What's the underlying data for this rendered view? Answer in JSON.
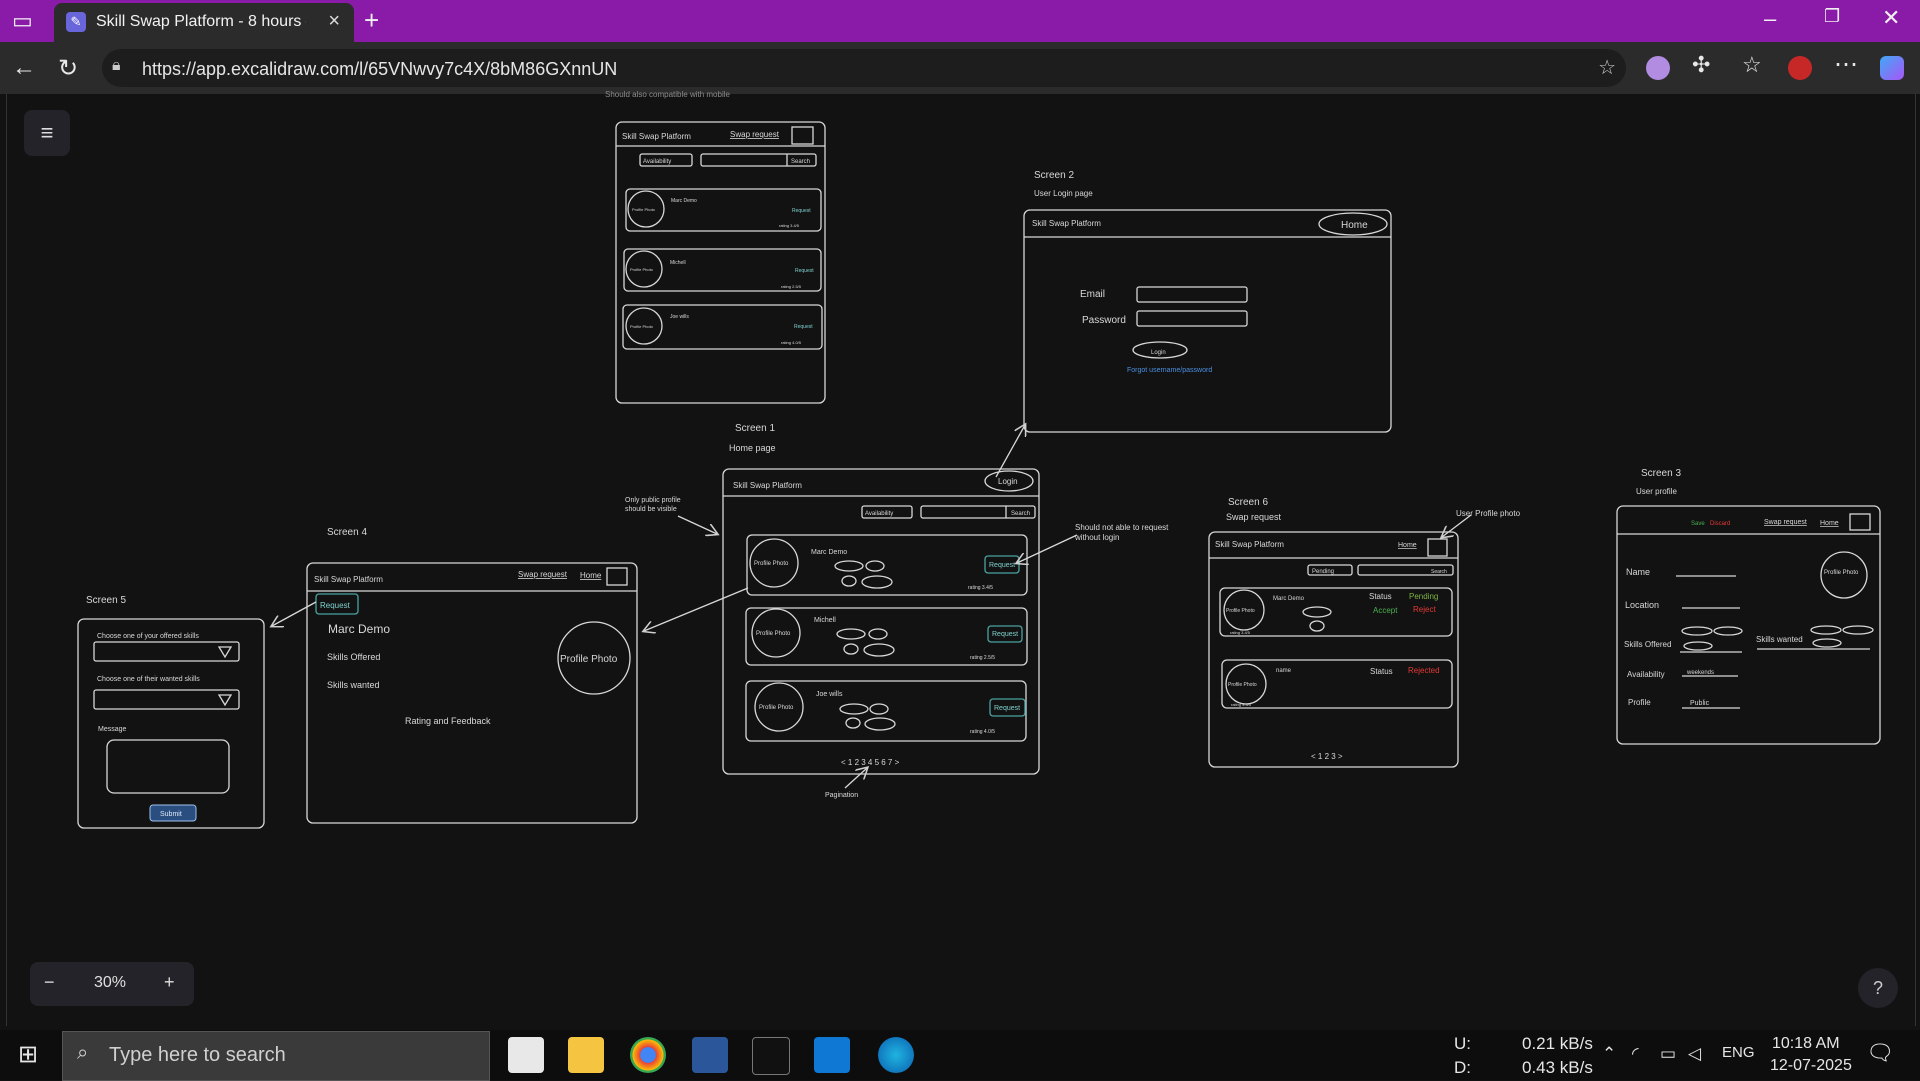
{
  "browser": {
    "tab_title": "Skill Swap Platform - 8 hours — E",
    "url": "https://app.excalidraw.com/l/65VNwvy7c4X/8bM86GXnnUN"
  },
  "canvas": {
    "top_note": "Should also compatible with mobile",
    "zoom": "30%",
    "screen0": {
      "brand": "Skill Swap Platform",
      "nav": "Swap request",
      "availability": "Availability",
      "search": "Search",
      "cards": [
        {
          "name": "Marc Demo",
          "photo": "Profile Photo",
          "btn": "Request",
          "rating": "rating 3.4/5"
        },
        {
          "name": "Michell",
          "photo": "Profile Photo",
          "btn": "Request",
          "rating": "rating 2.5/5"
        },
        {
          "name": "Joe wills",
          "photo": "Profile Photo",
          "btn": "Request",
          "rating": "rating 4.0/5"
        }
      ]
    },
    "screen1": {
      "label": "Screen 1",
      "sublabel": "Home page",
      "brand": "Skill Swap Platform",
      "login": "Login",
      "availability": "Availability",
      "search": "Search",
      "cards": [
        {
          "name": "Marc Demo",
          "photo": "Profile Photo",
          "btn": "Request",
          "rating": "rating 3.4/5"
        },
        {
          "name": "Michell",
          "photo": "Profile Photo",
          "btn": "Request",
          "rating": "rating 2.5/5"
        },
        {
          "name": "Joe wills",
          "photo": "Profile Photo",
          "btn": "Request",
          "rating": "rating 4.0/5"
        }
      ],
      "pagination": "< 1 2 3 4 5 6 7 >",
      "pagination_note": "Pagination",
      "public_note_1": "Only public profile",
      "public_note_2": "should be visible",
      "login_note_1": "Should not able to request",
      "login_note_2": "without login"
    },
    "screen2": {
      "label": "Screen 2",
      "sublabel": "User Login page",
      "brand": "Skill Swap Platform",
      "home": "Home",
      "email": "Email",
      "password": "Password",
      "login": "Login",
      "forgot": "Forgot username/password"
    },
    "screen3": {
      "label": "Screen 3",
      "sublabel": "User profile",
      "save": "Save",
      "discard": "Discard",
      "nav": "Swap request",
      "home": "Home",
      "name": "Name",
      "location": "Location",
      "skills_offered": "Skills Offered",
      "skills_wanted": "Skills wanted",
      "availability": "Availability",
      "availability_value": "weekends",
      "profile": "Profile",
      "profile_value": "Public",
      "photo": "Profile Photo"
    },
    "screen4": {
      "label": "Screen 4",
      "brand": "Skill Swap Platform",
      "nav": "Swap request",
      "home": "Home",
      "request": "Request",
      "name": "Marc Demo",
      "skills_offered": "Skills Offered",
      "skills_wanted": "Skills wanted",
      "rating": "Rating and Feedback",
      "photo": "Profile Photo"
    },
    "screen5": {
      "label": "Screen 5",
      "offered": "Choose one of your offered skills",
      "wanted": "Choose one of their wanted skills",
      "message": "Message",
      "submit": "Submit"
    },
    "screen6": {
      "label": "Screen 6",
      "sublabel": "Swap request",
      "brand": "Skill Swap Platform",
      "home": "Home",
      "filter": "Pending",
      "search": "Search",
      "photo_note": "User Profile photo",
      "req1": {
        "name": "Marc Demo",
        "photo": "Profile Photo",
        "status": "Status",
        "status_value": "Pending",
        "accept": "Accept",
        "reject": "Reject",
        "rating": "rating 3.4/5"
      },
      "req2": {
        "name": "name",
        "photo": "Profile Photo",
        "status": "Status",
        "status_value": "Rejected",
        "rating": "rating 3.4/5"
      },
      "pagination": "< 1 2 3 >"
    }
  },
  "taskbar": {
    "search_placeholder": "Type here to search",
    "net_up_label": "U:",
    "net_up": "0.21 kB/s",
    "net_down_label": "D:",
    "net_down": "0.43 kB/s",
    "lang": "ENG",
    "time": "10:18 AM",
    "date": "12-07-2025"
  }
}
